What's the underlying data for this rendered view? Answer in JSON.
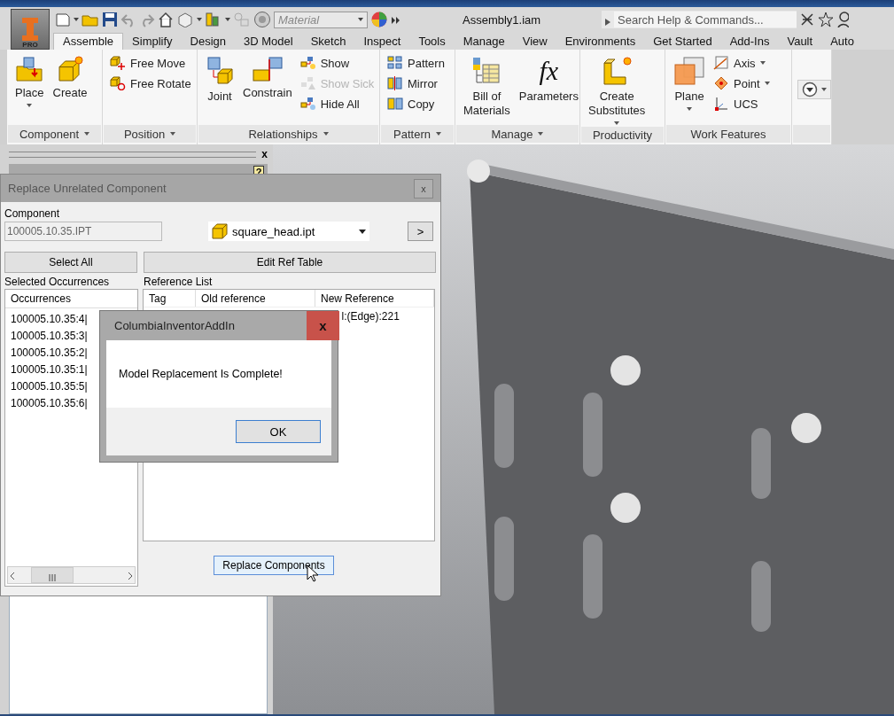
{
  "title_bar": {
    "app_badge": "PRO",
    "material": {
      "placeholder": "Material"
    },
    "document_title": "Assembly1.iam",
    "search": {
      "placeholder": "Search Help & Commands..."
    }
  },
  "tabs": [
    {
      "label": "Assemble",
      "selected": true
    },
    {
      "label": "Simplify",
      "selected": false
    },
    {
      "label": "Design",
      "selected": false
    },
    {
      "label": "3D Model",
      "selected": false
    },
    {
      "label": "Sketch",
      "selected": false
    },
    {
      "label": "Inspect",
      "selected": false
    },
    {
      "label": "Tools",
      "selected": false
    },
    {
      "label": "Manage",
      "selected": false
    },
    {
      "label": "View",
      "selected": false
    },
    {
      "label": "Environments",
      "selected": false
    },
    {
      "label": "Get Started",
      "selected": false
    },
    {
      "label": "Add-Ins",
      "selected": false
    },
    {
      "label": "Vault",
      "selected": false
    },
    {
      "label": "Auto",
      "selected": false
    }
  ],
  "ribbon": {
    "panels": [
      {
        "label": "Component",
        "dropdown": true,
        "tools": [
          {
            "kind": "large",
            "label": "Place",
            "dropdown": true,
            "disabled": false
          },
          {
            "kind": "large",
            "label": "Create",
            "dropdown": false,
            "disabled": false
          }
        ]
      },
      {
        "label": "Position",
        "dropdown": true,
        "tools": [
          {
            "kind": "small",
            "label": "Free Move",
            "dropdown": false,
            "disabled": false
          },
          {
            "kind": "small",
            "label": "Free Rotate",
            "dropdown": false,
            "disabled": false
          }
        ]
      },
      {
        "label": "Relationships",
        "dropdown": true,
        "tools": [
          {
            "kind": "large",
            "label": "Joint",
            "dropdown": false,
            "disabled": false
          },
          {
            "kind": "large",
            "label": "Constrain",
            "dropdown": false,
            "disabled": false
          },
          {
            "kind": "small",
            "label": "Show",
            "dropdown": false,
            "disabled": false
          },
          {
            "kind": "small",
            "label": "Show Sick",
            "dropdown": false,
            "disabled": true
          },
          {
            "kind": "small",
            "label": "Hide All",
            "dropdown": false,
            "disabled": false
          }
        ]
      },
      {
        "label": "Pattern",
        "dropdown": true,
        "tools": [
          {
            "kind": "small",
            "label": "Pattern",
            "dropdown": false,
            "disabled": false
          },
          {
            "kind": "small",
            "label": "Mirror",
            "dropdown": false,
            "disabled": false
          },
          {
            "kind": "small",
            "label": "Copy",
            "dropdown": false,
            "disabled": false
          }
        ]
      },
      {
        "label": "Manage",
        "dropdown": true,
        "tools": [
          {
            "kind": "large",
            "label": "Bill of\nMaterials",
            "dropdown": false,
            "disabled": false
          },
          {
            "kind": "large",
            "label": "Parameters",
            "glyph": "fx",
            "dropdown": false,
            "disabled": false
          }
        ]
      },
      {
        "label": "Productivity",
        "dropdown": false,
        "tools": [
          {
            "kind": "large",
            "label": "Create\nSubstitutes",
            "dropdown": true,
            "disabled": false
          }
        ]
      },
      {
        "label": "Work Features",
        "dropdown": false,
        "tools": [
          {
            "kind": "large",
            "label": "Plane",
            "dropdown": true,
            "disabled": false
          },
          {
            "kind": "small",
            "label": "Axis",
            "dropdown": true,
            "disabled": false
          },
          {
            "kind": "small",
            "label": "Point",
            "dropdown": true,
            "disabled": false
          },
          {
            "kind": "small",
            "label": "UCS",
            "dropdown": false,
            "disabled": false
          }
        ]
      },
      {
        "dropdown": false,
        "tools": [
          {
            "kind": "icon",
            "dropdown": true,
            "disabled": false
          }
        ]
      }
    ]
  },
  "browser_pane": {
    "close": "x",
    "help": "?"
  },
  "replace_dialog": {
    "title": "Replace Unrelated Component",
    "close": "x",
    "component_label": "Component",
    "component_field": {
      "value": "100005.10.35.IPT"
    },
    "replacement_combo": {
      "value": "square_head.ipt"
    },
    "next_button": ">",
    "select_all_button": "Select All",
    "edit_ref_table_button": "Edit Ref Table",
    "occurrences_label": "Selected Occurrences",
    "reference_label": "Reference List",
    "occurrences": {
      "header": "Occurrences",
      "items": [
        "100005.10.35:4|",
        "100005.10.35:3|",
        "100005.10.35:2|",
        "100005.10.35:1|",
        "100005.10.35:5|",
        "100005.10.35:6|"
      ]
    },
    "reference_table": {
      "columns": [
        "Tag",
        "Old reference",
        "New Reference"
      ],
      "rows": [
        {
          "new_reference": "l:(Edge):221"
        }
      ]
    },
    "replace_button": "Replace Components"
  },
  "message_box": {
    "title": "ColumbiaInventorAddIn",
    "close": "x",
    "message": "Model Replacement Is Complete!",
    "ok_button": "OK"
  }
}
